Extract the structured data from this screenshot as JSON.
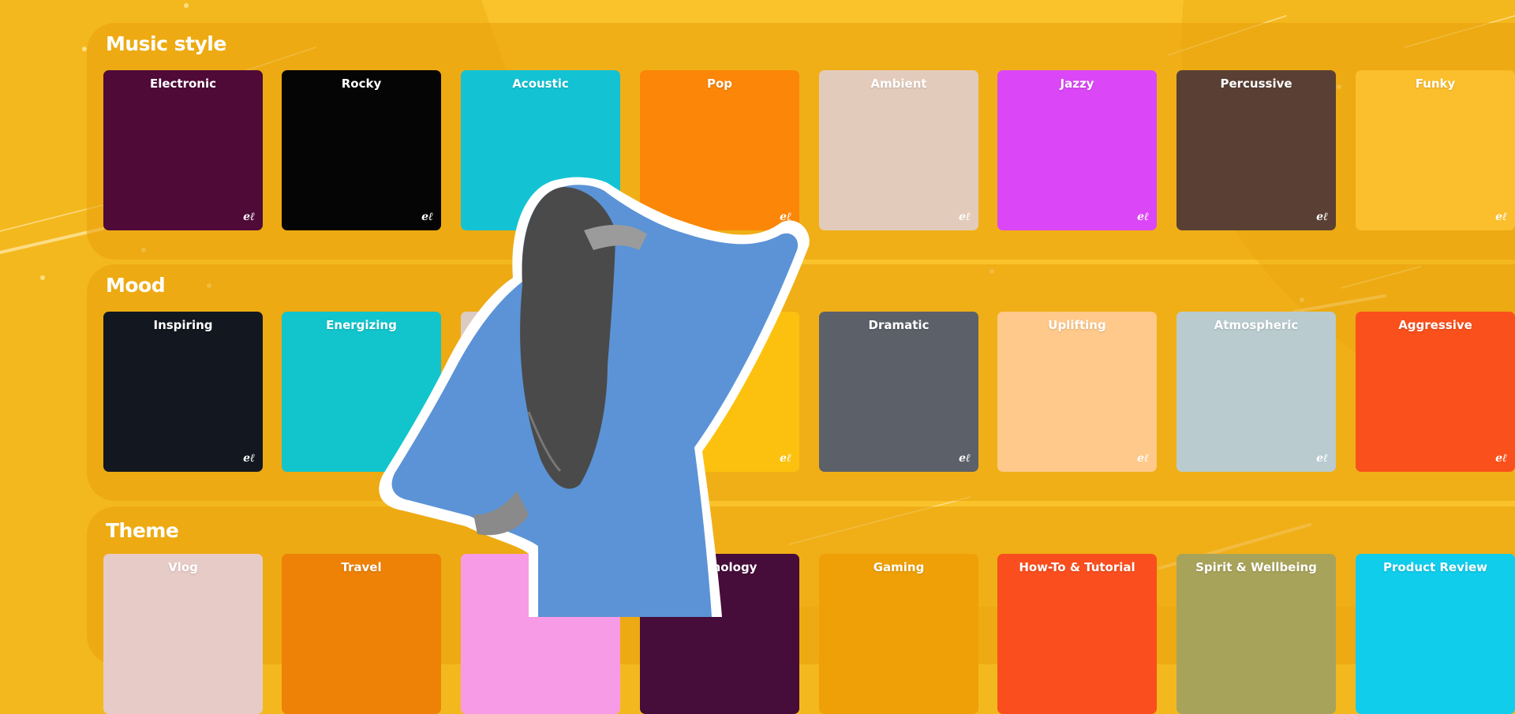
{
  "sections": [
    {
      "title": "Music style",
      "cards": [
        {
          "label": "Electronic",
          "bg": "#4F0A38",
          "art": "headphones-image"
        },
        {
          "label": "Rocky",
          "bg": "#050505",
          "art": "guitarist-image"
        },
        {
          "label": "Acoustic",
          "bg": "#13C3D3",
          "art": "acoustic-guitar-image"
        },
        {
          "label": "Pop",
          "bg": "#FB8607",
          "art": "pop-dancer-image"
        },
        {
          "label": "Ambient",
          "bg": "#E3CBBB",
          "art": "seashell-image"
        },
        {
          "label": "Jazzy",
          "bg": "#DB47F7",
          "art": "saxophonist-image"
        },
        {
          "label": "Percussive",
          "bg": "#5A4034",
          "art": "drum-image"
        },
        {
          "label": "Funky",
          "bg": "#FBBE2C",
          "art": "boombox-girl-image"
        }
      ]
    },
    {
      "title": "Mood",
      "cards": [
        {
          "label": "Inspiring",
          "bg": "#131820",
          "art": "earth-image"
        },
        {
          "label": "Energizing",
          "bg": "#12C5CC",
          "art": "snowboarder-image"
        },
        {
          "label": "",
          "bg": "#DCCBC0",
          "art": "hidden-card-image"
        },
        {
          "label": "",
          "bg": "#FCC10F",
          "art": "laughing-woman-image"
        },
        {
          "label": "Dramatic",
          "bg": "#5C6069",
          "art": "mountains-image"
        },
        {
          "label": "Uplifting",
          "bg": "#FEC98A",
          "art": "arms-up-image"
        },
        {
          "label": "Atmospheric",
          "bg": "#B9CBCF",
          "art": "foggy-forest-image"
        },
        {
          "label": "Aggressive",
          "bg": "#FA501C",
          "art": "boxer-image"
        }
      ]
    },
    {
      "title": "Theme",
      "cards": [
        {
          "label": "Vlog",
          "bg": "#E7CBC6",
          "art": "vlogger-image"
        },
        {
          "label": "Travel",
          "bg": "#EE8207",
          "art": "travel-image"
        },
        {
          "label": "",
          "bg": "#F89BE6",
          "art": "hidden-card-image"
        },
        {
          "label": "Technology",
          "bg": "#460C3A",
          "art": "tech-image"
        },
        {
          "label": "Gaming",
          "bg": "#EEA006",
          "art": "gaming-image"
        },
        {
          "label": "How-To & Tutorial",
          "bg": "#FA4E1E",
          "art": "tutorial-girl-image"
        },
        {
          "label": "Spirit & Wellbeing",
          "bg": "#A8A35A",
          "art": "wellbeing-image"
        },
        {
          "label": "Product Review",
          "bg": "#10CDEC",
          "art": "product-box-image"
        }
      ]
    }
  ],
  "watermark": "eℓ",
  "overlay": "woman-scratching-head-image",
  "colors": {
    "background": "#F4B81F",
    "panel": "#EBA50F",
    "text": "#FFFFFF"
  }
}
